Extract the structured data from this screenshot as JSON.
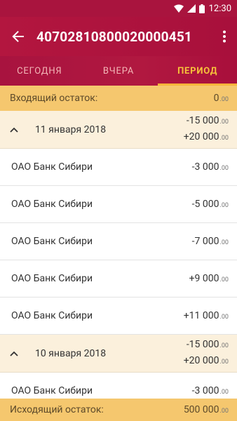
{
  "status_bar": {
    "time": "12:30"
  },
  "app_bar": {
    "title": "40702810800020000451"
  },
  "tabs": [
    {
      "label": "СЕГОДНЯ"
    },
    {
      "label": "ВЧЕРА"
    },
    {
      "label": "ПЕРИОД"
    }
  ],
  "opening_balance": {
    "label": "Входящий остаток:",
    "amount": "0",
    "cents": ".00"
  },
  "groups": [
    {
      "date": "11 января 2018",
      "debit": "-15 000",
      "debit_cents": ".00",
      "credit": "+20 000",
      "credit_cents": ".00",
      "items": [
        {
          "name": "ОАО Банк Сибири",
          "amount": "-3 000",
          "cents": ".00"
        },
        {
          "name": "ОАО Банк Сибири",
          "amount": "-5 000",
          "cents": ".00"
        },
        {
          "name": "ОАО Банк Сибири",
          "amount": "-7 000",
          "cents": ".00"
        },
        {
          "name": "ОАО Банк Сибири",
          "amount": "+9 000",
          "cents": ".00"
        },
        {
          "name": "ОАО Банк Сибири",
          "amount": "+11 000",
          "cents": ".00"
        }
      ]
    },
    {
      "date": "10 января 2018",
      "debit": "-15 000",
      "debit_cents": ".00",
      "credit": "+20 000",
      "credit_cents": ".00",
      "items": [
        {
          "name": "ОАО Банк Сибири",
          "amount": "-3 000",
          "cents": ".00"
        }
      ]
    }
  ],
  "closing_balance": {
    "label": "Исходящий остаток:",
    "amount": "500 000",
    "cents": ".00"
  },
  "colors": {
    "primary": "#a9143e",
    "accent": "#f6b43a",
    "balance_bg": "#f5c76e",
    "group_bg": "#fbf0dc"
  }
}
